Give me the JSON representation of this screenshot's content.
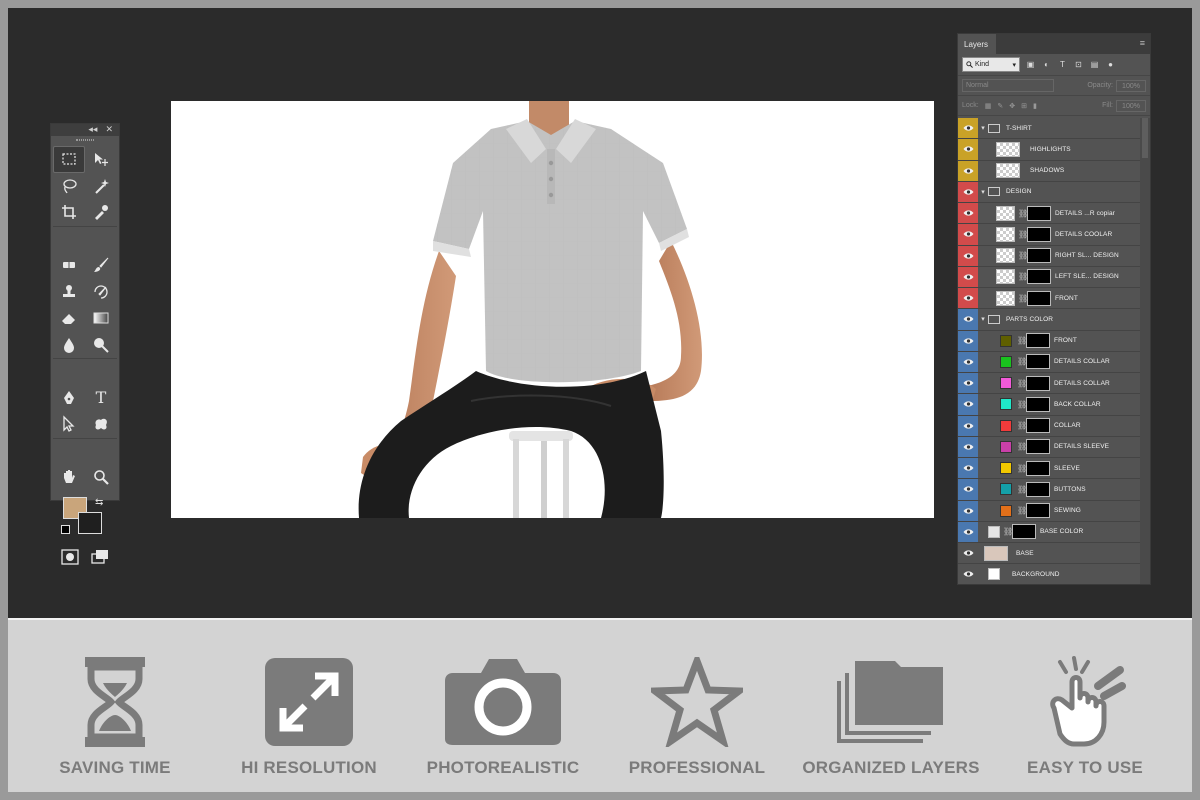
{
  "tools_panel": {
    "collapse_glyph": "◂◂",
    "close_glyph": "✕",
    "tools": [
      "rectangular-marquee-icon",
      "move-icon",
      "lasso-icon",
      "magic-wand-icon",
      "crop-icon",
      "eyedropper-icon",
      "healing-brush-icon",
      "brush-icon",
      "clone-stamp-icon",
      "history-brush-icon",
      "eraser-icon",
      "gradient-icon",
      "blur-icon",
      "dodge-icon",
      "pen-icon",
      "type-icon",
      "path-selection-icon",
      "shape-icon",
      "hand-icon",
      "zoom-icon"
    ],
    "type_glyph": "T",
    "foreground_color": "#c9a57b",
    "background_color": "#1f1f1f"
  },
  "layers_panel": {
    "tab_label": "Layers",
    "menu_glyph": "≡",
    "kind_label": "Kind",
    "blend_mode": "Normal",
    "opacity_label": "Opacity:",
    "opacity_value": "100%",
    "lock_label": "Lock:",
    "fill_label": "Fill:",
    "fill_value": "100%",
    "layers": [
      {
        "name": "T-SHIRT",
        "type": "group",
        "color": "#c9a227"
      },
      {
        "name": "HIGHLIGHTS",
        "type": "smart",
        "color": "#c9a227"
      },
      {
        "name": "SHADOWS",
        "type": "plain",
        "color": "#c9a227"
      },
      {
        "name": "DESIGN",
        "type": "group",
        "color": "#d24b4b"
      },
      {
        "name": "DETAILS ...R copiar",
        "type": "masked",
        "color": "#d24b4b"
      },
      {
        "name": "DETAILS COOLAR",
        "type": "masked",
        "color": "#d24b4b"
      },
      {
        "name": "RIGHT SL... DESIGN",
        "type": "masked",
        "color": "#d24b4b"
      },
      {
        "name": "LEFT SLE... DESIGN",
        "type": "masked",
        "color": "#d24b4b"
      },
      {
        "name": "FRONT",
        "type": "masked",
        "color": "#d24b4b"
      },
      {
        "name": "PARTS COLOR",
        "type": "group",
        "color": "#4a78b0"
      },
      {
        "name": "FRONT",
        "type": "fill",
        "fill": "#5f5f00",
        "color": "#4a78b0"
      },
      {
        "name": "DETAILS COLLAR",
        "type": "fill",
        "fill": "#19c21e",
        "color": "#4a78b0"
      },
      {
        "name": "DETAILS COLLAR",
        "type": "fill",
        "fill": "#f25ad9",
        "color": "#4a78b0"
      },
      {
        "name": "BACK COLLAR",
        "type": "fill",
        "fill": "#1fe8c8",
        "color": "#4a78b0"
      },
      {
        "name": "COLLAR",
        "type": "fill",
        "fill": "#f23b3b",
        "color": "#4a78b0"
      },
      {
        "name": "DETAILS SLEEVE",
        "type": "fill",
        "fill": "#c940a8",
        "color": "#4a78b0"
      },
      {
        "name": "SLEEVE",
        "type": "fill",
        "fill": "#f2c800",
        "color": "#4a78b0"
      },
      {
        "name": "BUTTONS",
        "type": "fill",
        "fill": "#14a0a8",
        "color": "#4a78b0"
      },
      {
        "name": "SEWING",
        "type": "fill",
        "fill": "#e2701a",
        "color": "#4a78b0"
      },
      {
        "name": "BASE COLOR",
        "type": "basecolor",
        "color": "#4a78b0"
      },
      {
        "name": "BASE",
        "type": "image",
        "color": "#535353"
      },
      {
        "name": "BACKGROUND",
        "type": "white",
        "color": "#535353"
      }
    ]
  },
  "features": [
    {
      "label": "SAVING TIME",
      "icon": "hourglass-icon"
    },
    {
      "label": "HI RESOLUTION",
      "icon": "expand-arrows-icon"
    },
    {
      "label": "PHOTOREALISTIC",
      "icon": "camera-icon"
    },
    {
      "label": "PROFESSIONAL",
      "icon": "star-icon"
    },
    {
      "label": "ORGANIZED LAYERS",
      "icon": "stacked-folders-icon"
    },
    {
      "label": "EASY TO USE",
      "icon": "pointing-hand-icon"
    }
  ]
}
